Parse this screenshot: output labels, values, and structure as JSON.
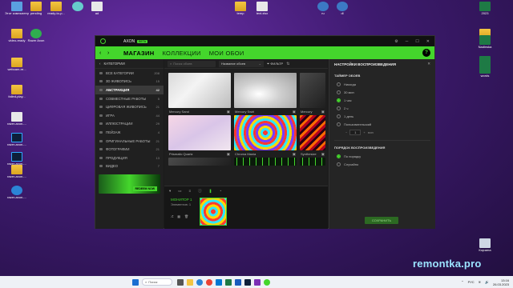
{
  "desktop": {
    "icons_left": [
      {
        "label": "Этот компьютер",
        "kind": "pc"
      },
      {
        "label": "pending",
        "kind": "folder"
      },
      {
        "label": "ready-to-p...",
        "kind": "folder"
      },
      {
        "label": "",
        "kind": "user"
      },
      {
        "label": "ad",
        "kind": "file"
      },
      {
        "label": "video-ready",
        "kind": "folder"
      },
      {
        "label": "Razer Axon",
        "kind": "green"
      },
      {
        "label": "webcam-re...",
        "kind": "folder"
      },
      {
        "label": "failed-play...",
        "kind": "folder"
      },
      {
        "label": "razer-axon-...",
        "kind": "file"
      },
      {
        "label": "razer-axon-...",
        "kind": "ps"
      },
      {
        "label": "razer-axon-...",
        "kind": "ps"
      },
      {
        "label": "razer-axon-...",
        "kind": "folder"
      },
      {
        "label": "razer-axon-...",
        "kind": "edge"
      }
    ],
    "icons_right": [
      {
        "label": "temp",
        "kind": "folder"
      },
      {
        "label": "text.xlsx",
        "kind": "file"
      },
      {
        "label": "ru",
        "kind": "disk"
      },
      {
        "label": "dl",
        "kind": "disk"
      },
      {
        "label": "2023",
        "kind": "xl"
      },
      {
        "label": "",
        "kind": "folder"
      },
      {
        "label": "Nadinska",
        "kind": "xl"
      },
      {
        "label": "",
        "kind": "xl"
      },
      {
        "label": "words",
        "kind": "xl"
      },
      {
        "label": "Корзина",
        "kind": "bin"
      }
    ]
  },
  "app": {
    "title": "AXON",
    "badge": "BETA",
    "nav": {
      "back": "‹",
      "forward": "›",
      "tabs": [
        "МАГАЗИН",
        "КОЛЛЕКЦИИ",
        "МОИ ОБОИ"
      ],
      "help": "?"
    },
    "sidebar": {
      "header": "КАТЕГОРИИ",
      "items": [
        {
          "label": "ВСЕ КАТЕГОРИИ",
          "count": "208"
        },
        {
          "label": "3D ЖИВОПИСЬ",
          "count": "15"
        },
        {
          "label": "АБСТРАКЦИЯ",
          "count": "42"
        },
        {
          "label": "СОВМЕСТНЫЕ РАБОТЫ",
          "count": "5"
        },
        {
          "label": "ЦИФРОВАЯ ЖИВОПИСЬ",
          "count": "21"
        },
        {
          "label": "ИГРА",
          "count": "44"
        },
        {
          "label": "ИЛЛЮСТРАЦИИ",
          "count": "29"
        },
        {
          "label": "ПЕЙЗАЖ",
          "count": "4"
        },
        {
          "label": "ОРИГИНАЛЬНЫЕ РАБОТЫ",
          "count": "21"
        },
        {
          "label": "ФОТОГРАФИИ",
          "count": "21"
        },
        {
          "label": "ПРОДУКЦИЯ",
          "count": "13"
        },
        {
          "label": "ВИДЕО",
          "count": "7"
        }
      ],
      "promo_button": "REDEEM NOW"
    },
    "toolbar": {
      "search_placeholder": "Поиск обоев",
      "sort": "Название обоев",
      "filter": "ФИЛЬТР"
    },
    "wallpapers": [
      {
        "name": "Mercury Sand",
        "style": "t-sand"
      },
      {
        "name": "Mercury Swirl",
        "style": "t-swirl"
      },
      {
        "name": "Mercury",
        "style": "t-dark"
      },
      {
        "name": "Prismatic Quartz",
        "style": "t-quartz"
      },
      {
        "name": "Chroma Mania",
        "style": "t-mania"
      },
      {
        "name": "Synthesize",
        "style": "t-synth"
      }
    ],
    "player": {
      "monitor": "МОНИТОР 1",
      "elements": "Элементов: 1"
    },
    "settings": {
      "title": "НАСТРОЙКИ ВОСПРОИЗВЕДЕНИЯ",
      "timer_title": "ТАЙМЕР ОБОЕВ",
      "timer_options": [
        "Никогда",
        "30 мин",
        "1 час",
        "2 ч",
        "1 день",
        "Пользовательский"
      ],
      "timer_selected": 2,
      "custom_value": "1",
      "custom_unit": "мин",
      "order_title": "ПОРЯДОК ВОСПРОИЗВЕДЕНИЯ",
      "order_options": [
        "По порядку",
        "Случайно"
      ],
      "order_selected": 0,
      "save": "СОХРАНИТЬ"
    }
  },
  "watermark": "remontka.pro",
  "taskbar": {
    "search": "Поиск",
    "lang": "РУС",
    "time": "13:16",
    "date": "26.03.2023"
  },
  "colors": {
    "accent": "#44d62c",
    "panel": "#1b1b1b"
  }
}
